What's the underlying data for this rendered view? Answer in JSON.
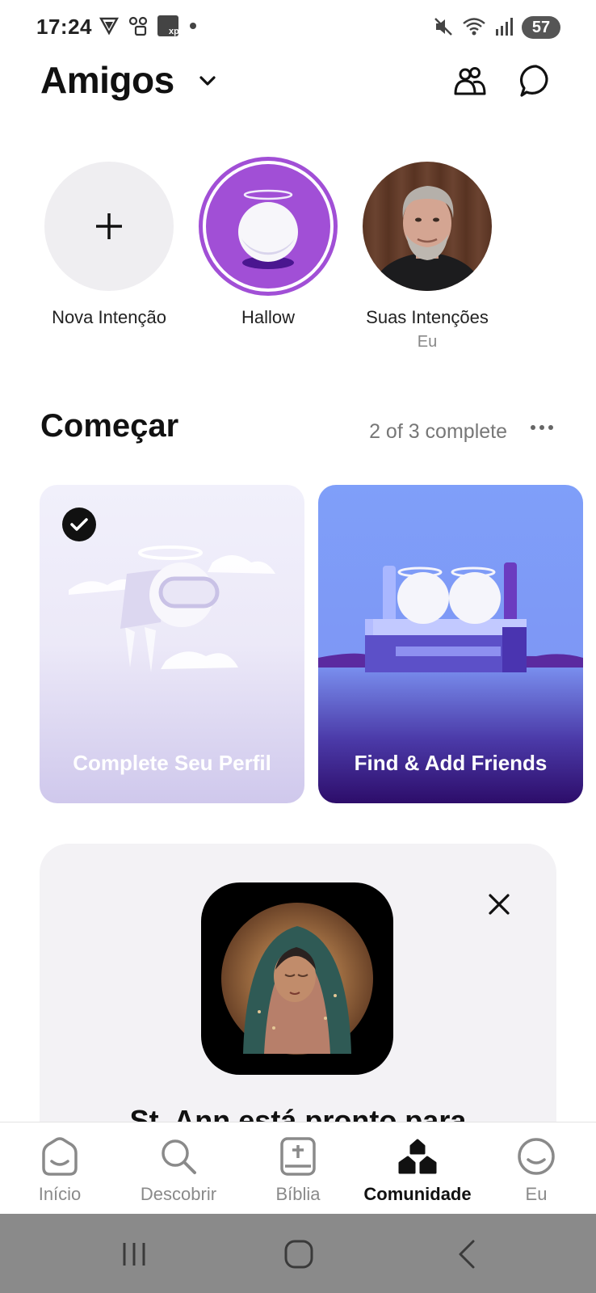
{
  "status_bar": {
    "time": "17:24",
    "battery": "57",
    "left_icons": [
      "vpn-icon",
      "voicemail-icon",
      "xp-app-icon",
      "dot-icon"
    ],
    "right_icons": [
      "mute-icon",
      "wifi-icon",
      "signal-icon"
    ]
  },
  "header": {
    "title": "Amigos"
  },
  "stories": [
    {
      "label": "Nova Intenção",
      "sublabel": ""
    },
    {
      "label": "Hallow",
      "sublabel": ""
    },
    {
      "label": "Suas Intenções",
      "sublabel": "Eu"
    }
  ],
  "getting_started": {
    "title": "Começar",
    "progress": "2 of 3 complete",
    "cards": [
      {
        "label": "Complete Seu Perfil",
        "completed": true
      },
      {
        "label": "Find & Add Friends",
        "completed": false
      }
    ]
  },
  "promo": {
    "text": "St. Ann está pronto para"
  },
  "bottom_nav": [
    {
      "label": "Início",
      "icon": "home-icon",
      "active": false
    },
    {
      "label": "Descobrir",
      "icon": "search-icon",
      "active": false
    },
    {
      "label": "Bíblia",
      "icon": "bible-icon",
      "active": false
    },
    {
      "label": "Comunidade",
      "icon": "community-icon",
      "active": true
    },
    {
      "label": "Eu",
      "icon": "profile-icon",
      "active": false
    }
  ],
  "colors": {
    "accent_purple": "#a14fd6",
    "card_blue": "#7f9ff9",
    "card_dark": "#2d0d6a",
    "nav_active": "#111111",
    "nav_inactive": "#8a8a8a"
  }
}
